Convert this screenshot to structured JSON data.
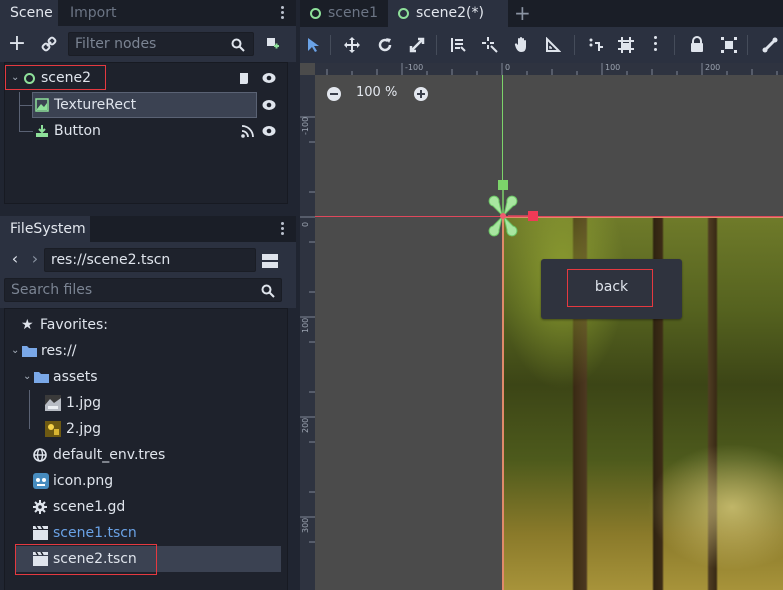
{
  "left_dock": {
    "scene_tab": "Scene",
    "import_tab": "Import",
    "filter_placeholder": "Filter nodes",
    "nodes": [
      {
        "label": "scene2"
      },
      {
        "label": "TextureRect"
      },
      {
        "label": "Button"
      }
    ]
  },
  "filesystem": {
    "tab": "FileSystem",
    "path": "res://scene2.tscn",
    "search_placeholder": "Search files",
    "favorites_label": "Favorites:",
    "root": "res://",
    "items": [
      {
        "label": "assets"
      },
      {
        "label": "1.jpg"
      },
      {
        "label": "2.jpg"
      },
      {
        "label": "default_env.tres"
      },
      {
        "label": "icon.png"
      },
      {
        "label": "scene1.gd"
      },
      {
        "label": "scene1.tscn"
      },
      {
        "label": "scene2.tscn"
      }
    ]
  },
  "editor": {
    "tabs": [
      {
        "label": "scene1"
      },
      {
        "label": "scene2(*)"
      }
    ],
    "zoom_label": "100 %",
    "ruler_h": [
      "-100",
      "0",
      "100",
      "200"
    ],
    "ruler_v": [
      "-100",
      "0",
      "100",
      "200",
      "300"
    ],
    "button_text": "back"
  },
  "colors": {
    "accent_green": "#8ee09a",
    "selection_red": "#e53940",
    "link_blue": "#6aa2e6"
  }
}
